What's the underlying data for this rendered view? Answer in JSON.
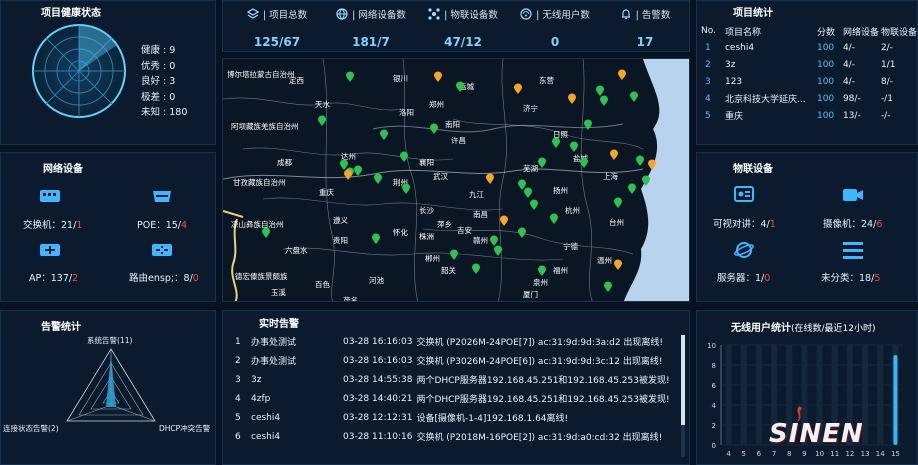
{
  "health": {
    "title": "项目健康状态",
    "items": [
      {
        "label": "健康",
        "value": "9"
      },
      {
        "label": "优秀",
        "value": "0"
      },
      {
        "label": "良好",
        "value": "3"
      },
      {
        "label": "极差",
        "value": "0"
      },
      {
        "label": "未知",
        "value": "180"
      }
    ]
  },
  "top_stats": [
    {
      "label": "项目总数",
      "value": "125/67",
      "icon": "layers-icon"
    },
    {
      "label": "网络设备数",
      "value": "181/7",
      "icon": "globe-icon"
    },
    {
      "label": "物联设备数",
      "value": "47/12",
      "icon": "network-icon"
    },
    {
      "label": "无线用户数",
      "value": "0",
      "icon": "wifi-icon"
    },
    {
      "label": "告警数",
      "value": "17",
      "icon": "bell-icon"
    }
  ],
  "network": {
    "title": "网络设备",
    "items": [
      {
        "label": "交换机：",
        "value": "21/",
        "alert": "1",
        "icon": "switch-icon"
      },
      {
        "label": "POE：",
        "value": "15/",
        "alert": "4",
        "icon": "poe-icon"
      },
      {
        "label": "AP：",
        "value": "137/",
        "alert": "2",
        "icon": "ap-icon"
      },
      {
        "label": "路由ensp;：",
        "value": "8/",
        "alert": "0",
        "icon": "router-icon"
      }
    ]
  },
  "alarm_stats": {
    "title": "告警统计",
    "labels": [
      "系统告警(11)",
      "连接状态告警(2)",
      "DHCP冲突告警"
    ]
  },
  "project_stats": {
    "title": "项目统计",
    "headers": [
      "No.",
      "项目名称",
      "分数",
      "网络设备",
      "物联设备"
    ],
    "rows": [
      {
        "no": "1",
        "name": "ceshi4",
        "score": "100",
        "net": "4/-",
        "iot": "2/-"
      },
      {
        "no": "2",
        "name": "3z",
        "score": "100",
        "net": "4/-",
        "iot": "1/1"
      },
      {
        "no": "3",
        "name": "123",
        "score": "100",
        "net": "4/-",
        "iot": "8/-"
      },
      {
        "no": "4",
        "name": "北京科技大学延庆...",
        "score": "100",
        "net": "98/-",
        "iot": "-/1"
      },
      {
        "no": "5",
        "name": "重庆",
        "score": "100",
        "net": "13/-",
        "iot": "-/-"
      }
    ]
  },
  "iot": {
    "title": "物联设备",
    "items": [
      {
        "label": "可视对讲：",
        "value": "4/",
        "alert": "1",
        "icon": "intercom-icon"
      },
      {
        "label": "摄像机：",
        "value": "24/",
        "alert": "6",
        "icon": "camera-icon"
      },
      {
        "label": "服务器：",
        "value": "1/",
        "alert": "0",
        "icon": "server-icon"
      },
      {
        "label": "未分类：",
        "value": "18/",
        "alert": "5",
        "icon": "list-icon"
      }
    ]
  },
  "realtime_alarms": {
    "title": "实时告警",
    "rows": [
      {
        "no": "1",
        "project": "办事处测试",
        "time": "03-28  16:16:03",
        "msg": "交换机 (P2026M-24POE[7])  ac:31:9d:9d:3a:d2  出现离线!"
      },
      {
        "no": "2",
        "project": "办事处测试",
        "time": "03-28  16:16:03",
        "msg": "交换机 (P3026M-24POE[6])  ac:31:9d:9d:3c:12  出现离线!"
      },
      {
        "no": "3",
        "project": "3z",
        "time": "03-28  14:55:38",
        "msg": "两个DHCP服务器192.168.45.251和192.168.45.253被发现!"
      },
      {
        "no": "4",
        "project": "4zfp",
        "time": "03-28  14:40:21",
        "msg": "两个DHCP服务器192.168.45.251和192.168.45.253被发现!"
      },
      {
        "no": "5",
        "project": "ceshi4",
        "time": "03-28  12:12:31",
        "msg": "设备[摄像机-1-4]192.168.1.64离线!"
      },
      {
        "no": "6",
        "project": "ceshi4",
        "time": "03-28  11:10:16",
        "msg": "交换机 (P2018M-16POE[2])  ac:31:9d:a0:cd:32  出现离线!"
      }
    ]
  },
  "wireless": {
    "title": "无线用户统计",
    "subtitle": "(在线数/最近12小时)",
    "watermark": "SINEN"
  },
  "chart_data": {
    "type": "bar",
    "title": "无线用户统计",
    "subtitle": "(在线数/最近12小时)",
    "yticks": [
      0,
      2,
      4,
      6,
      8,
      10
    ],
    "ylim": [
      0,
      10
    ],
    "categories": [
      "4",
      "5",
      "6",
      "7",
      "8",
      "9",
      "10",
      "11",
      "12",
      "13",
      "14",
      "15"
    ],
    "values": [
      0,
      0,
      0,
      0,
      0,
      0,
      0,
      0,
      0,
      0,
      0,
      9
    ]
  },
  "map": {
    "labels": [
      "博尔塔拉蒙古自治州",
      "定西",
      "银川",
      "运城",
      "东营",
      "阿坝藏族羌族自治州",
      "天水",
      "南阳",
      "济宁",
      "日照",
      "甘孜藏族自治州",
      "成都",
      "达州",
      "襄阳",
      "盐城",
      "重庆",
      "荆州",
      "武汉",
      "芜湖",
      "上海",
      "凉山彝族自治州",
      "遵义",
      "长沙",
      "南昌",
      "杭州",
      "六盘水",
      "贵阳",
      "怀化",
      "赣州",
      "宁德",
      "德宏傣族景颇族",
      "玉溪",
      "百色",
      "河池",
      "韶关",
      "茂名",
      "台州",
      "福州",
      "九江",
      "扬州",
      "吉安",
      "萍乡",
      "株洲",
      "郴州",
      "郑州",
      "许昌",
      "洛阳",
      "泉州",
      "厦门",
      "温州"
    ],
    "colors": {
      "green": "#2ec24f",
      "orange": "#f5a623"
    }
  },
  "colors": {
    "accent": "#4fc3f7",
    "alert": "#ff4545",
    "panel": "#0b1b2d",
    "value": "#7fd3ff"
  }
}
